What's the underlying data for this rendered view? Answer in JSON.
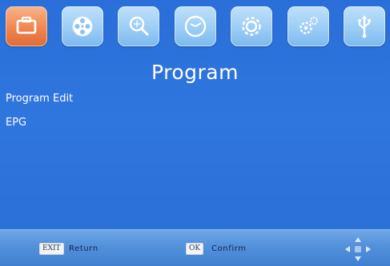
{
  "topbar": {
    "tabs": [
      {
        "icon": "program-icon",
        "active": true
      },
      {
        "icon": "film-reel-icon",
        "active": false
      },
      {
        "icon": "search-icon",
        "active": false
      },
      {
        "icon": "clock-icon",
        "active": false
      },
      {
        "icon": "settings-gear-icon",
        "active": false
      },
      {
        "icon": "system-gears-icon",
        "active": false
      },
      {
        "icon": "usb-icon",
        "active": false
      }
    ]
  },
  "main": {
    "title": "Program",
    "items": [
      {
        "label": "Program Edit"
      },
      {
        "label": "EPG"
      }
    ]
  },
  "footer": {
    "exit_key": "EXIT",
    "exit_label": "Return",
    "ok_key": "OK",
    "ok_label": "Confirm",
    "nav_icon": "directional-arrows-icon"
  },
  "colors": {
    "background": "#2f76de",
    "active_tab": "#ef8650",
    "inactive_tab": "#9fcff6",
    "text": "#ffffff"
  }
}
